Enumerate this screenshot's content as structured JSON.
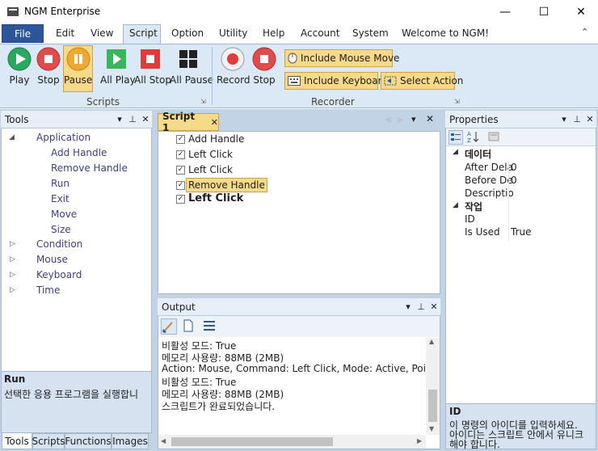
{
  "window": {
    "title": "NGM Enterprise",
    "minimize": "—",
    "maximize": "☐",
    "close": "✕"
  },
  "menu": {
    "file": "File",
    "items": [
      "Edit",
      "View",
      "Script",
      "Option",
      "Utility",
      "Help",
      "Account",
      "System"
    ],
    "welcome": "Welcome to NGM!",
    "collapse_glyph": "⌃"
  },
  "ribbon": {
    "buttons": {
      "play": "Play",
      "stop": "Stop",
      "pause": "Pause",
      "all_play": "All Play",
      "all_stop": "All Stop",
      "all_pause": "All Pause",
      "record": "Record",
      "rec_stop": "Stop"
    },
    "options": {
      "include_mouse_move": "Include Mouse Move",
      "include_keyboard": "Include Keyboard",
      "select_action": "Select Action"
    },
    "groups": {
      "scripts": "Scripts",
      "recorder": "Recorder"
    }
  },
  "tools": {
    "title": "Tools",
    "tree": {
      "application": "Application",
      "application_children": [
        "Add Handle",
        "Remove Handle",
        "Run",
        "Exit",
        "Move",
        "Size"
      ],
      "condition": "Condition",
      "mouse": "Mouse",
      "keyboard": "Keyboard",
      "time": "Time"
    },
    "desc_title": "Run",
    "desc_text": "선택한 응용 프로그램을 실행합니",
    "bottom_tabs": [
      "Tools",
      "Scripts",
      "Functions",
      "Images"
    ]
  },
  "script": {
    "tab_label": "Script 1",
    "items": [
      "Add Handle",
      "Left Click",
      "Left Click",
      "Remove Handle",
      "Left Click"
    ]
  },
  "output": {
    "title": "Output",
    "lines": [
      "비활성 모드: True",
      "메모리 사용량: 88MB (2MB)",
      "Action: Mouse, Command: Left Click, Mode: Active, Point: {X",
      "비활성 모드: True",
      "메모리 사용량: 88MB (2MB)",
      "스크립트가 완료되었습니다."
    ]
  },
  "properties": {
    "title": "Properties",
    "cat_data": "데이터",
    "data_rows": [
      {
        "name": "After Dela",
        "value": "0"
      },
      {
        "name": "Before De",
        "value": "0"
      },
      {
        "name": "Descriptio",
        "value": ""
      }
    ],
    "cat_work": "작업",
    "work_rows": [
      {
        "name": "ID",
        "value": ""
      },
      {
        "name": "Is Used",
        "value": "True"
      }
    ],
    "desc_title": "ID",
    "desc_lines": [
      "이 명령의 아이디를 입력하세요.",
      "아이디는 스크립트 안에서 유니크",
      "해야 합니다."
    ]
  },
  "colors": {
    "accent": "#2b579a",
    "highlight": "#f7d98a",
    "panel_bg": "#c3d3e6",
    "ribbon_bg": "#dbe8f5"
  }
}
